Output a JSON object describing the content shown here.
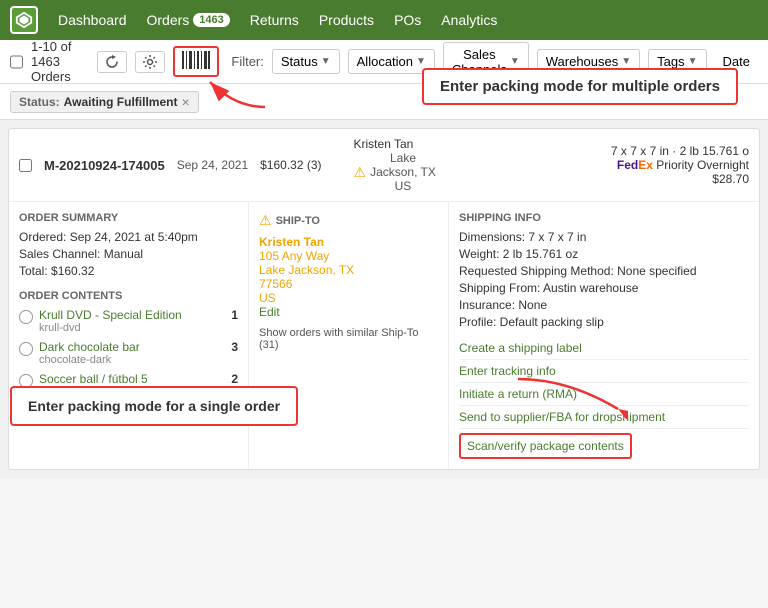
{
  "nav": {
    "logo_label": "ShipStation",
    "items": [
      {
        "label": "Dashboard",
        "badge": null
      },
      {
        "label": "Orders",
        "badge": "1463"
      },
      {
        "label": "Returns",
        "badge": null
      },
      {
        "label": "Products",
        "badge": null
      },
      {
        "label": "POs",
        "badge": null
      },
      {
        "label": "Analytics",
        "badge": null
      }
    ]
  },
  "subheader": {
    "order_count": "1-10 of 1463 Orders",
    "filter_label": "Filter:",
    "filters": [
      {
        "label": "Status",
        "has_caret": true
      },
      {
        "label": "Allocation",
        "has_caret": true
      },
      {
        "label": "Sales Channels",
        "has_caret": true
      },
      {
        "label": "Warehouses",
        "has_caret": true
      },
      {
        "label": "Tags",
        "has_caret": true
      },
      {
        "label": "Date",
        "has_caret": false
      }
    ]
  },
  "active_filter": {
    "label": "Status:",
    "value": "Awaiting Fulfillment",
    "close": "×"
  },
  "packing_tooltip_multiple": "Enter packing mode for multiple orders",
  "order": {
    "id": "M-20210924-174005",
    "date": "Sep 24, 2021",
    "amount": "$160.32 (3)",
    "customer": "Kristen Tan",
    "location": "Lake\nJackson, TX\nUS",
    "dimensions": "7 x 7 x 7 in · 2 lb 15.761 o",
    "shipping_method": "FedEx Priority Overnight",
    "shipping_cost": "$28.70",
    "summary": {
      "title": "ORDER SUMMARY",
      "ordered": "Ordered: Sep 24, 2021 at 5:40pm",
      "sales_channel": "Sales Channel: Manual",
      "total": "Total: $160.32"
    },
    "ship_to": {
      "title": "SHIP-TO",
      "name": "Kristen Tan",
      "address1": "105 Any Way",
      "city_state_zip": "Lake Jackson, TX",
      "zip": "77566",
      "country": "US",
      "edit": "Edit",
      "similar": "Show orders with similar Ship-To (31)"
    },
    "shipping_info": {
      "title": "SHIPPING INFO",
      "dimensions": "Dimensions: 7 x 7 x 7 in",
      "weight": "Weight: 2 lb  15.761 oz",
      "requested_method": "Requested Shipping Method: None specified",
      "shipping_from": "Shipping From: Austin warehouse",
      "insurance": "Insurance: None",
      "profile": "Profile: Default packing slip"
    },
    "contents": {
      "title": "ORDER CONTENTS",
      "items": [
        {
          "name": "Krull DVD - Special Edition",
          "sku": "krull-dvd",
          "qty": 1
        },
        {
          "name": "Dark chocolate bar",
          "sku": "chocolate-dark",
          "qty": 3
        },
        {
          "name": "Soccer ball / fútbol 5",
          "sku": "",
          "qty": 2
        }
      ]
    },
    "actions": [
      {
        "label": "Create a shipping label",
        "highlight": false
      },
      {
        "label": "Enter tracking info",
        "highlight": false
      },
      {
        "label": "Initiate a return (RMA)",
        "highlight": false
      },
      {
        "label": "Send to supplier/FBA for dropshipment",
        "highlight": false
      },
      {
        "label": "Scan/verify package contents",
        "highlight": true
      }
    ]
  },
  "packing_tooltip_single": "Enter packing mode for a single order"
}
